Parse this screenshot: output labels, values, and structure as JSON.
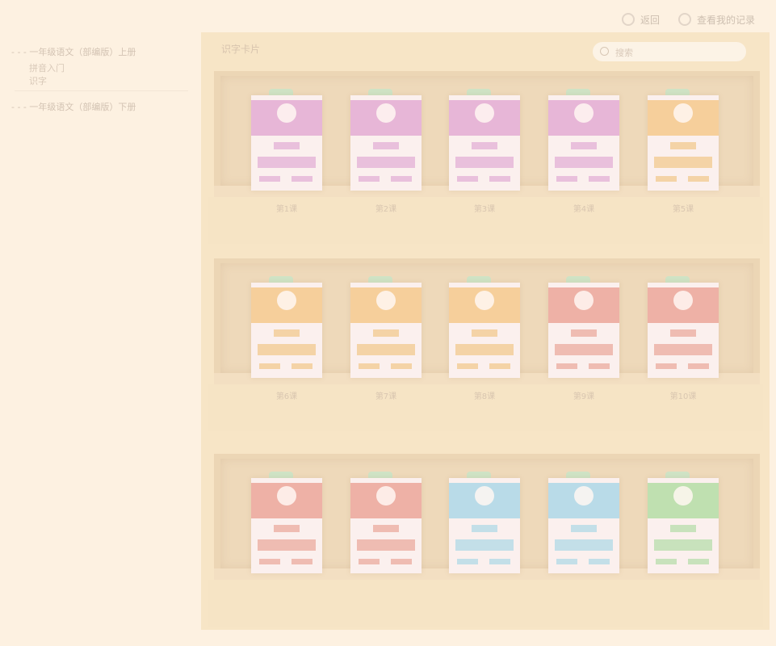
{
  "topbar": {
    "action1": {
      "label": "返回",
      "icon": "print-icon"
    },
    "action2": {
      "label": "查看我的记录",
      "icon": "globe-icon"
    }
  },
  "sidebar": {
    "tree": [
      {
        "label": "- - - 一年级语文（部编版）上册",
        "children": [
          "拼音入门",
          "识字"
        ]
      },
      {
        "label": "- - - 一年级语文（部编版）下册",
        "children": []
      }
    ]
  },
  "main": {
    "title": "识字卡片",
    "search_placeholder": "搜索"
  },
  "shelves": [
    {
      "items": [
        {
          "color": "pink",
          "caption": "第1课"
        },
        {
          "color": "pink",
          "caption": "第2课"
        },
        {
          "color": "pink",
          "caption": "第3课"
        },
        {
          "color": "pink",
          "caption": "第4课"
        },
        {
          "color": "orange",
          "caption": "第5课"
        }
      ]
    },
    {
      "items": [
        {
          "color": "orange",
          "caption": "第6课"
        },
        {
          "color": "orange",
          "caption": "第7课"
        },
        {
          "color": "orange",
          "caption": "第8课"
        },
        {
          "color": "red",
          "caption": "第9课"
        },
        {
          "color": "red",
          "caption": "第10课"
        }
      ]
    },
    {
      "items": [
        {
          "color": "red",
          "caption": ""
        },
        {
          "color": "red",
          "caption": ""
        },
        {
          "color": "blue",
          "caption": ""
        },
        {
          "color": "blue",
          "caption": ""
        },
        {
          "color": "green",
          "caption": ""
        }
      ]
    }
  ],
  "colors": {
    "background": "#fdf1e1",
    "shelf": "#ecd6b5",
    "pink": "#e7b6d7",
    "orange": "#f6cf9b",
    "red": "#eeb1a6",
    "blue": "#b9dbe8",
    "green": "#bfe0b0"
  }
}
